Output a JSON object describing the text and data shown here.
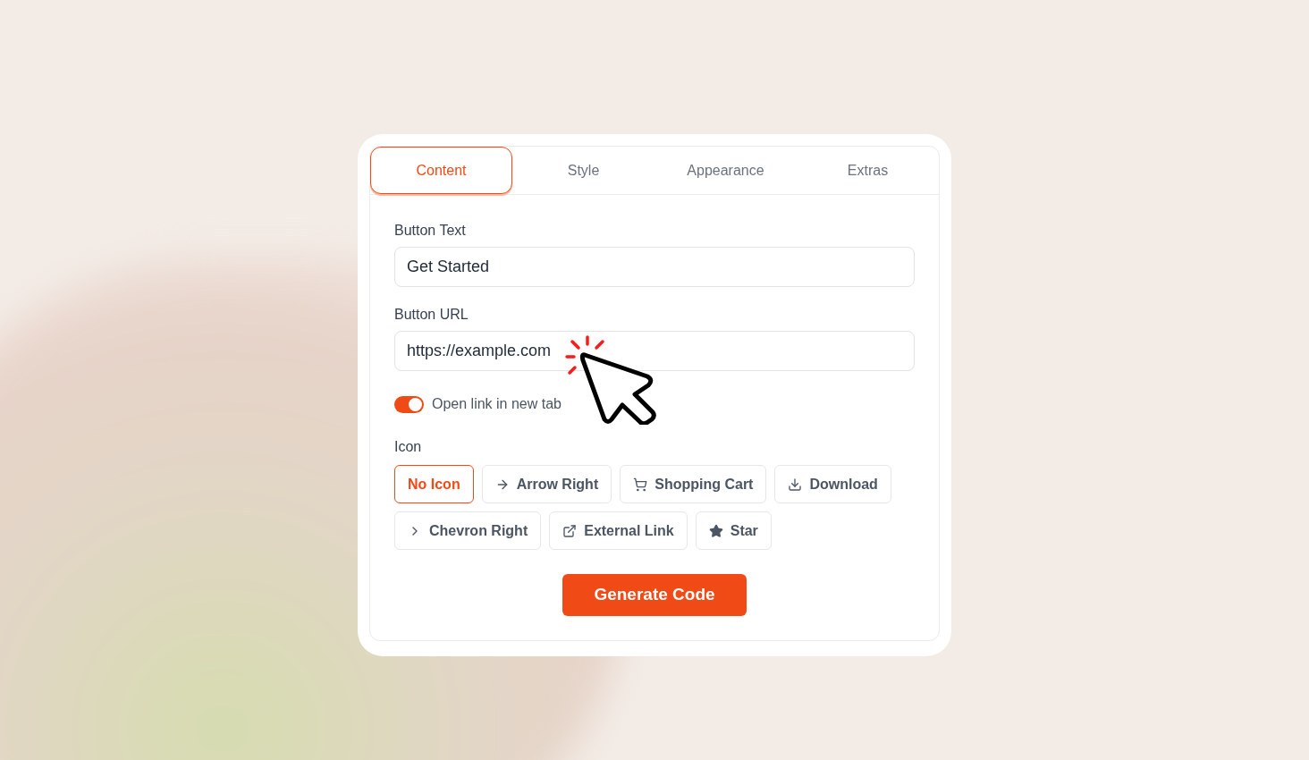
{
  "tabs": [
    {
      "label": "Content",
      "selected": true
    },
    {
      "label": "Style",
      "selected": false
    },
    {
      "label": "Appearance",
      "selected": false
    },
    {
      "label": "Extras",
      "selected": false
    }
  ],
  "fields": [
    {
      "label": "Button Text",
      "value": "Get Started"
    },
    {
      "label": "Button URL",
      "value": "https://example.com"
    }
  ],
  "new_tab_toggle": {
    "label": "Open link in new tab",
    "on": true
  },
  "icon_picker": {
    "label": "Icon",
    "options": [
      {
        "label": "No Icon",
        "kind": "none",
        "selected": true
      },
      {
        "label": "Arrow Right",
        "kind": "arrow-right",
        "selected": false
      },
      {
        "label": "Shopping Cart",
        "kind": "cart",
        "selected": false
      },
      {
        "label": "Download",
        "kind": "download",
        "selected": false
      },
      {
        "label": "Chevron Right",
        "kind": "chevron-right",
        "selected": false
      },
      {
        "label": "External Link",
        "kind": "external-link",
        "selected": false
      },
      {
        "label": "Star",
        "kind": "star",
        "selected": false
      }
    ]
  },
  "submit_button": "Generate Code"
}
